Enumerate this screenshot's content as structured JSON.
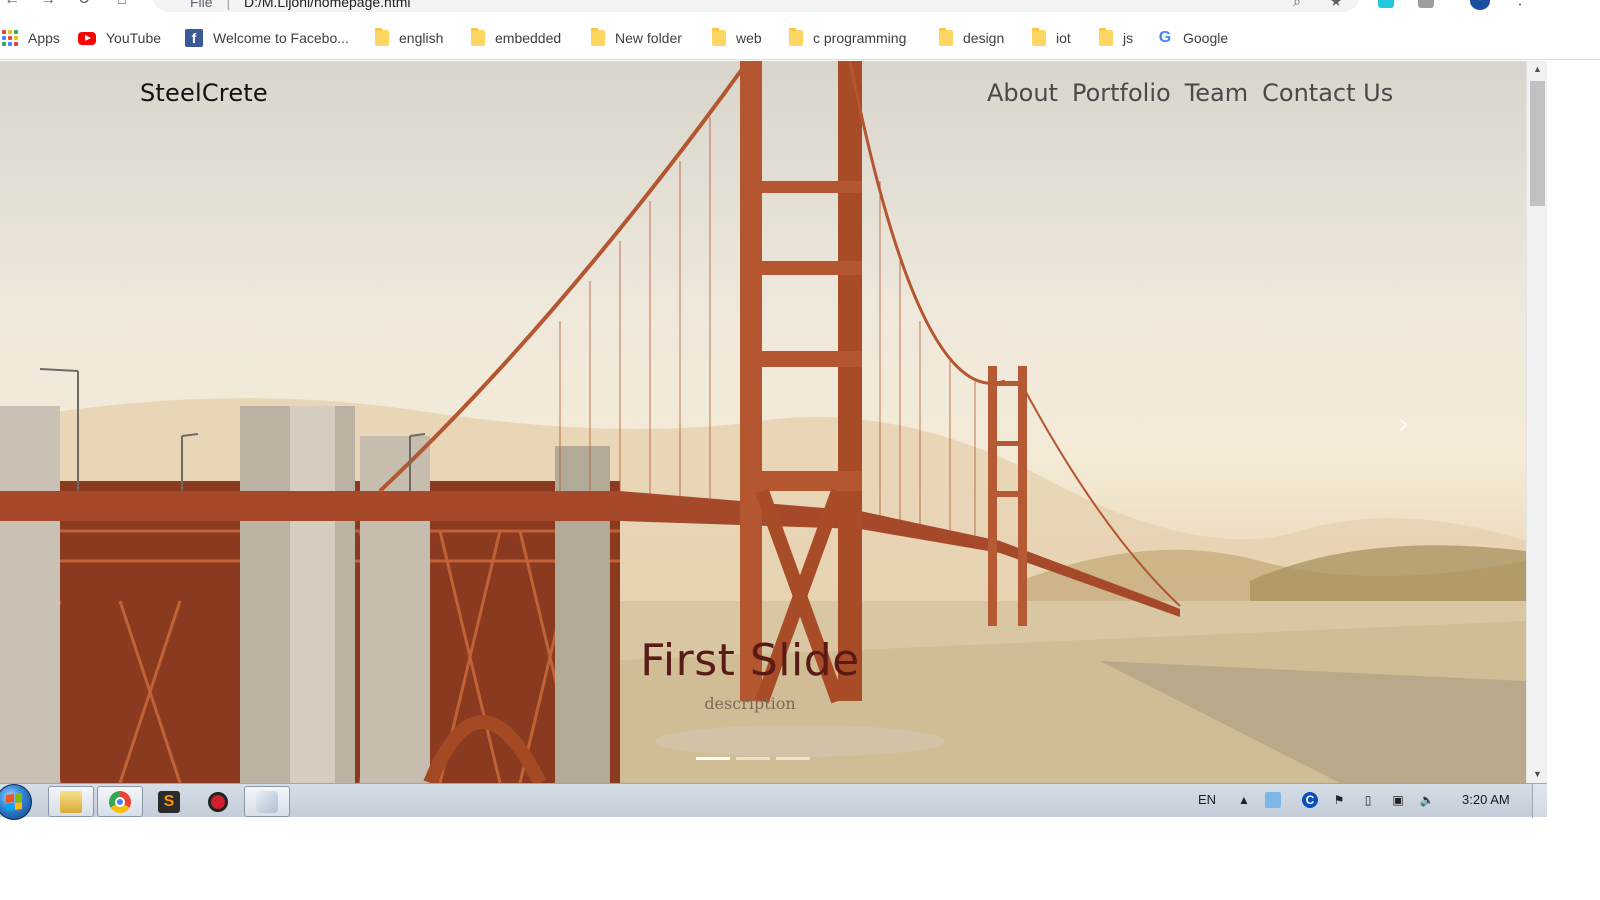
{
  "browser": {
    "address_scheme": "File",
    "address_path": "D:/M.Lijohi/homepage.html"
  },
  "bookmarks": [
    {
      "label": "Apps",
      "icon": "apps-grid-icon"
    },
    {
      "label": "YouTube",
      "icon": "youtube-icon"
    },
    {
      "label": "Welcome to Facebo...",
      "icon": "facebook-icon"
    },
    {
      "label": "english",
      "icon": "folder-icon"
    },
    {
      "label": "embedded",
      "icon": "folder-icon"
    },
    {
      "label": "New folder",
      "icon": "folder-icon"
    },
    {
      "label": "web",
      "icon": "folder-icon"
    },
    {
      "label": "c programming",
      "icon": "folder-icon"
    },
    {
      "label": "design",
      "icon": "folder-icon"
    },
    {
      "label": "iot",
      "icon": "folder-icon"
    },
    {
      "label": "js",
      "icon": "folder-icon"
    },
    {
      "label": "Google",
      "icon": "google-icon"
    }
  ],
  "site": {
    "brand": "SteelCrete",
    "nav": [
      "About",
      "Portfolio",
      "Team",
      "Contact Us"
    ]
  },
  "carousel": {
    "title": "First Slide",
    "description": "description",
    "slide_count": 3,
    "active_index": 0
  },
  "taskbar": {
    "language": "EN",
    "clock": "3:20 AM",
    "pinned": [
      "explorer-icon",
      "chrome-icon",
      "sublime-text-icon",
      "app-red-icon",
      "paint-icon"
    ]
  },
  "colors": {
    "slide_title": "#5a1b16",
    "bridge": "#b3532d",
    "taskbar": "#c4cdd8"
  }
}
